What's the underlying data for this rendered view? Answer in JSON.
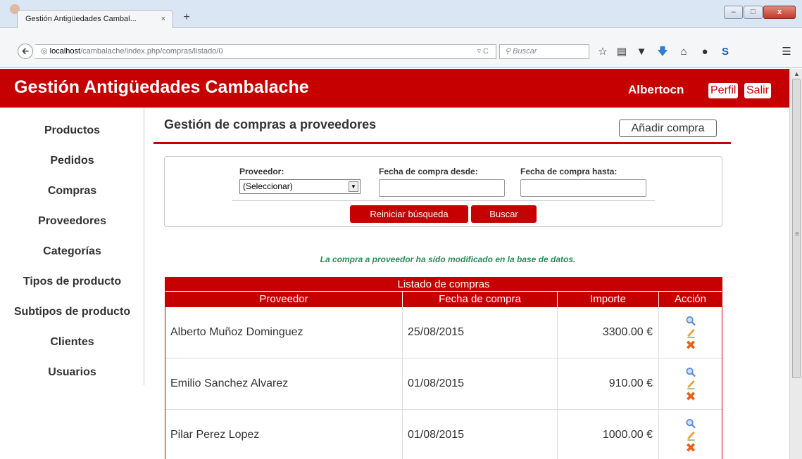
{
  "browser": {
    "tab_title": "Gestión Antigüedades Cambal...",
    "tab_close": "×",
    "new_tab": "+",
    "url_host": "localhost",
    "url_path": "/cambalache/index.php/compras/listado/0",
    "url_controls": "▿ C",
    "search_placeholder": "Buscar",
    "window_controls": {
      "minimize": "–",
      "maximize": "□",
      "close": "x"
    }
  },
  "header": {
    "site_title": "Gestión Antigüedades Cambalache",
    "user_name": "Albertocn",
    "profile_label": "Perfil",
    "logout_label": "Salir"
  },
  "sidebar": {
    "items": [
      {
        "label": "Productos"
      },
      {
        "label": "Pedidos"
      },
      {
        "label": "Compras"
      },
      {
        "label": "Proveedores"
      },
      {
        "label": "Categorías"
      },
      {
        "label": "Tipos de producto"
      },
      {
        "label": "Subtipos de producto"
      },
      {
        "label": "Clientes"
      },
      {
        "label": "Usuarios"
      }
    ]
  },
  "main": {
    "page_title": "Gestión de compras a proveedores",
    "add_button": "Añadir compra",
    "filters": {
      "provider_label": "Proveedor:",
      "provider_value": "(Seleccionar)",
      "date_from_label": "Fecha de compra desde:",
      "date_to_label": "Fecha de compra hasta:",
      "date_from_value": "",
      "date_to_value": "",
      "reset_button": "Reiniciar búsqueda",
      "search_button": "Buscar"
    },
    "success_message": "La compra a proveedor ha sído modificado en la base de datos.",
    "table": {
      "title": "Listado de compras",
      "columns": [
        "Proveedor",
        "Fecha de compra",
        "Importe",
        "Acción"
      ],
      "rows": [
        {
          "proveedor": "Alberto Muñoz Dominguez",
          "fecha": "25/08/2015",
          "importe": "3300.00 €"
        },
        {
          "proveedor": "Emilio Sanchez Alvarez",
          "fecha": "01/08/2015",
          "importe": "910.00 €"
        },
        {
          "proveedor": "Pilar Perez Lopez",
          "fecha": "01/08/2015",
          "importe": "1000.00 €"
        }
      ]
    }
  },
  "colors": {
    "brand_red": "#c60000",
    "success_green": "#2e8b57",
    "action_view": "#5b8fd6",
    "action_edit": "#e8a23a",
    "action_delete": "#e8601c"
  }
}
